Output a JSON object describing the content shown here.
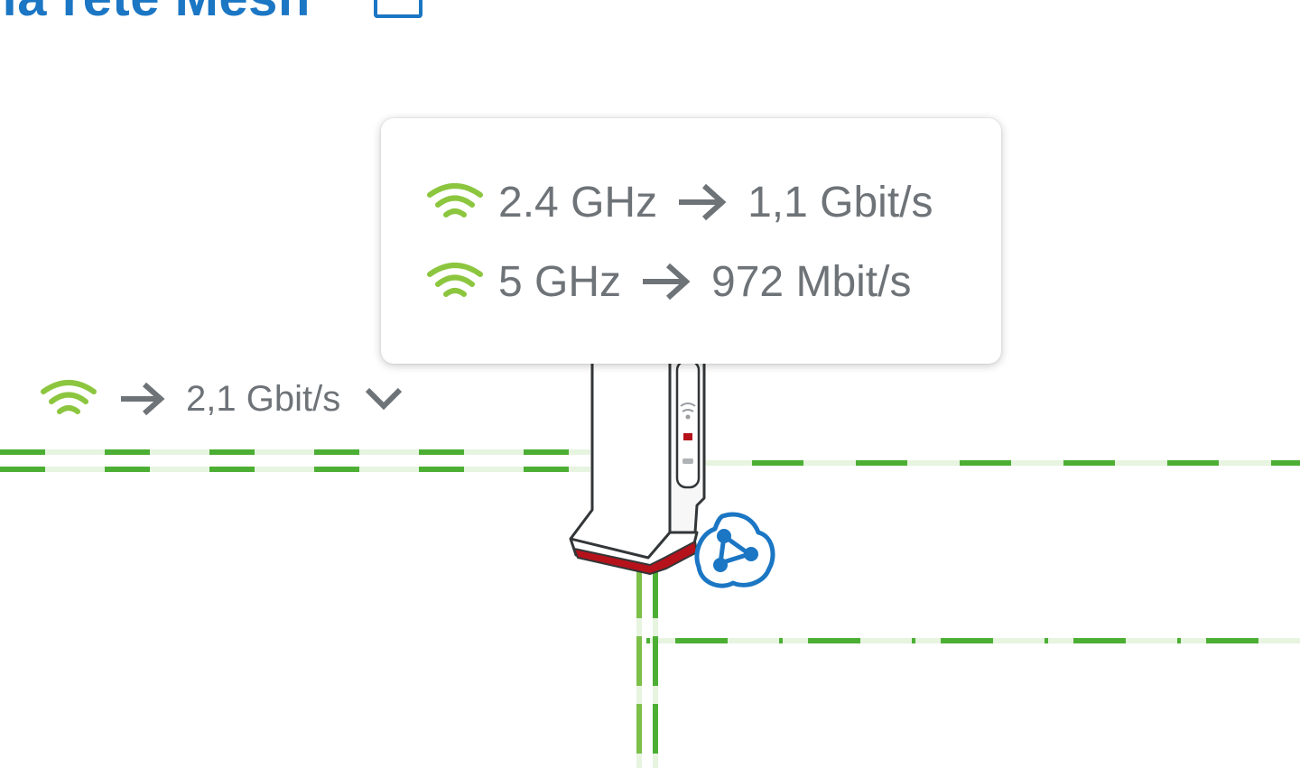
{
  "header": {
    "title": "lla rete Mesh"
  },
  "uplink": {
    "speed": "2,1 Gbit/s"
  },
  "tooltip": {
    "bands": [
      {
        "band": "2.4 GHz",
        "speed": "1,1 Gbit/s"
      },
      {
        "band": "5 GHz",
        "speed": "972 Mbit/s"
      }
    ]
  },
  "colors": {
    "accent": "#1b76c4",
    "link_green": "#4caf34",
    "link_green_light": "#e6f4e0",
    "wifi_green": "#8cc63f",
    "text_gray": "#6e7378",
    "device_red": "#b5121b"
  },
  "icons": {
    "title_icon": "window-icon",
    "wifi": "wifi-icon",
    "arrow": "arrow-right-icon",
    "expand": "chevron-down-icon",
    "mesh": "mesh-icon"
  }
}
